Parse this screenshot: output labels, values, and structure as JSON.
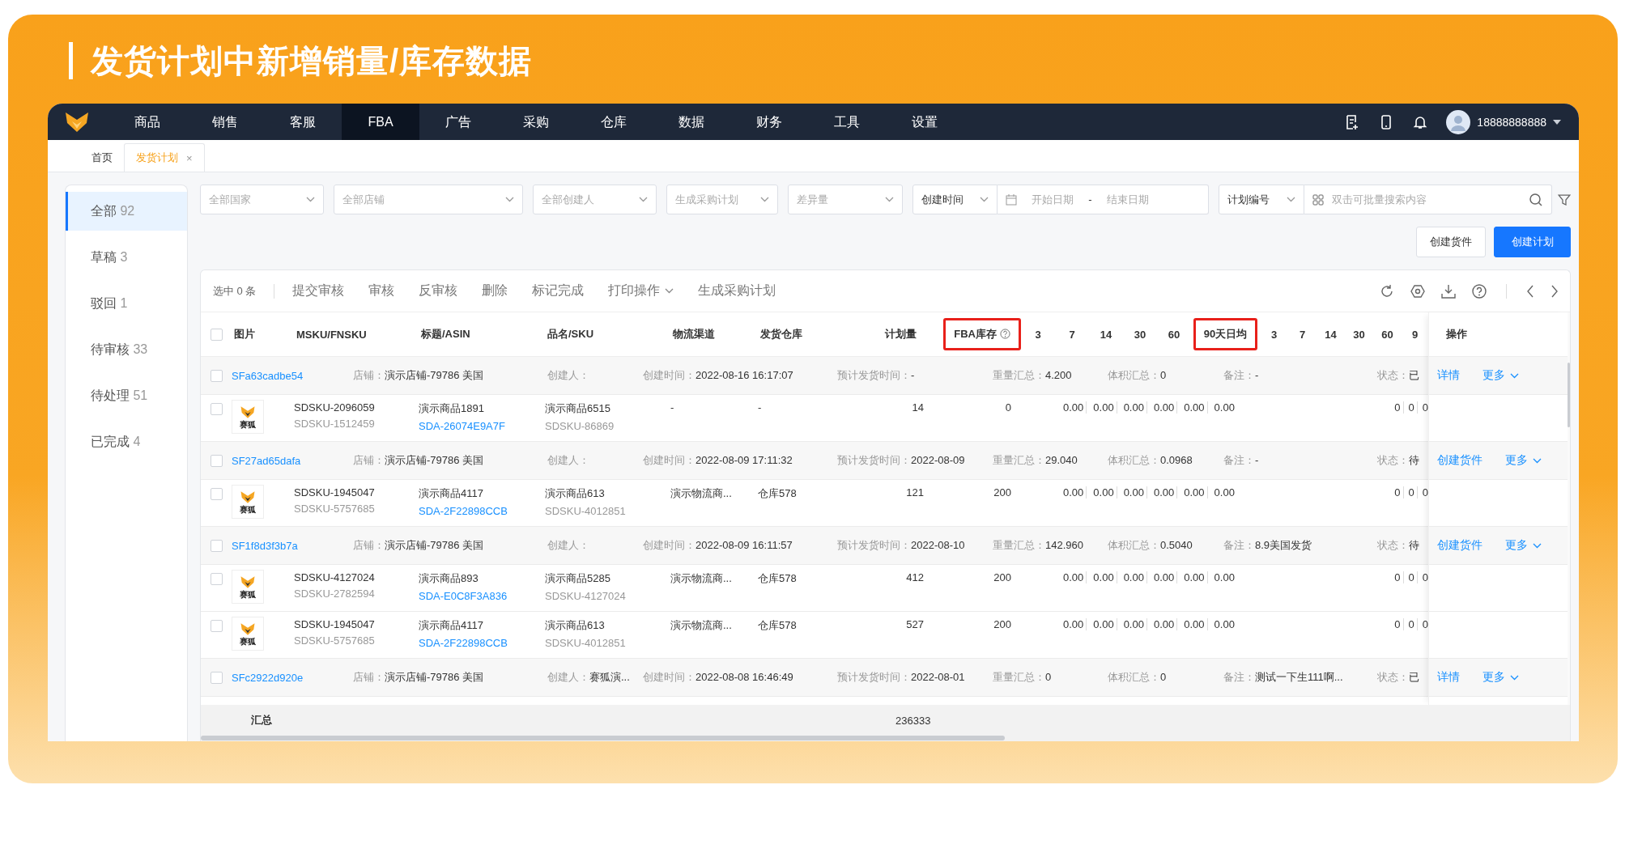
{
  "banner": {
    "title": "发货计划中新增销量/库存数据"
  },
  "nav": {
    "items": [
      {
        "label": "商品",
        "selected": false
      },
      {
        "label": "销售",
        "selected": false
      },
      {
        "label": "客服",
        "selected": false
      },
      {
        "label": "FBA",
        "selected": true
      },
      {
        "label": "广告",
        "selected": false
      },
      {
        "label": "采购",
        "selected": false
      },
      {
        "label": "仓库",
        "selected": false
      },
      {
        "label": "数据",
        "selected": false
      },
      {
        "label": "财务",
        "selected": false
      },
      {
        "label": "工具",
        "selected": false
      },
      {
        "label": "设置",
        "selected": false
      }
    ],
    "user": "18888888888"
  },
  "tabs": [
    {
      "label": "首页",
      "selected": false
    },
    {
      "label": "发货计划",
      "selected": true,
      "close": "×"
    }
  ],
  "sidebar": {
    "items": [
      {
        "label": "全部",
        "count": "92",
        "selected": true
      },
      {
        "label": "草稿",
        "count": "3",
        "selected": false
      },
      {
        "label": "驳回",
        "count": "1",
        "selected": false
      },
      {
        "label": "待审核",
        "count": "33",
        "selected": false
      },
      {
        "label": "待处理",
        "count": "51",
        "selected": false
      },
      {
        "label": "已完成",
        "count": "4",
        "selected": false
      }
    ]
  },
  "filters": [
    {
      "kind": "select",
      "placeholder": "全部国家"
    },
    {
      "kind": "select",
      "placeholder": "全部店铺"
    },
    {
      "kind": "select",
      "placeholder": "全部创建人"
    },
    {
      "kind": "select",
      "placeholder": "生成采购计划"
    },
    {
      "kind": "select",
      "placeholder": "差异量"
    },
    {
      "kind": "select",
      "value": "创建时间",
      "joined": true
    },
    {
      "kind": "daterange",
      "start": "开始日期",
      "separator": "-",
      "end": "结束日期"
    },
    {
      "kind": "select",
      "value": "计划编号",
      "joined": true
    },
    {
      "kind": "search",
      "placeholder": "双击可批量搜索内容"
    }
  ],
  "buttons": [
    {
      "label": "创建货件",
      "primary": false
    },
    {
      "label": "创建计划",
      "primary": true
    }
  ],
  "toolbar": {
    "selection": "选中 0 条",
    "actions": [
      {
        "label": "提交审核",
        "dropdown": false
      },
      {
        "label": "审核",
        "dropdown": false
      },
      {
        "label": "反审核",
        "dropdown": false
      },
      {
        "label": "删除",
        "dropdown": false
      },
      {
        "label": "标记完成",
        "dropdown": false
      },
      {
        "label": "打印操作",
        "dropdown": true
      },
      {
        "label": "生成采购计划",
        "dropdown": false
      }
    ]
  },
  "table": {
    "checked": false,
    "columns": [
      {
        "label": "图片",
        "highlighted": false
      },
      {
        "label": "MSKU/FNSKU",
        "highlighted": false
      },
      {
        "label": "标题/ASIN",
        "highlighted": false
      },
      {
        "label": "品名/SKU",
        "highlighted": false
      },
      {
        "label": "物流渠道",
        "highlighted": false
      },
      {
        "label": "发货仓库",
        "highlighted": false
      },
      {
        "label": "计划量",
        "highlighted": false
      },
      {
        "label": "FBA库存",
        "highlighted": true,
        "help": true
      },
      {
        "label": "3",
        "highlighted": false
      },
      {
        "label": "7",
        "highlighted": false
      },
      {
        "label": "14",
        "highlighted": false
      },
      {
        "label": "30",
        "highlighted": false
      },
      {
        "label": "60",
        "highlighted": false
      },
      {
        "label": "90天日均",
        "highlighted": true
      },
      {
        "label": "3",
        "highlighted": false
      },
      {
        "label": "7",
        "highlighted": false
      },
      {
        "label": "14",
        "highlighted": false
      },
      {
        "label": "30",
        "highlighted": false
      },
      {
        "label": "60",
        "highlighted": false
      },
      {
        "label": "9",
        "highlighted": false
      }
    ],
    "actions_column": "操作",
    "groups": [
      {
        "code": "SFa63cadbe54",
        "checked": false,
        "fields": [
          {
            "label": "店铺：",
            "value": "演示店铺-79786 美国"
          },
          {
            "label": "创建人："
          },
          {
            "label": "创建时间：",
            "value": "2022-08-16 16:17:07"
          },
          {
            "label": "预计发货时间：",
            "value": "-"
          },
          {
            "label": "重量汇总：",
            "value": "4.200"
          },
          {
            "label": "体积汇总：",
            "value": "0"
          },
          {
            "label": "备注：",
            "value": "-"
          },
          {
            "label": "状态：",
            "value": "已"
          }
        ],
        "ops": [
          {
            "label": "详情",
            "dropdown": false
          },
          {
            "label": "更多",
            "dropdown": true
          }
        ],
        "items": [
          {
            "checked": false,
            "image_text": "赛狐",
            "msku": "SDSKU-2096059",
            "fnsku": "SDSKU-1512459",
            "title": "演示商品1891",
            "asin": "SDA-26074E9A7F",
            "name": "演示商品6515",
            "sku": "SDSKU-86869",
            "logistics": "-",
            "warehouse": "-",
            "plan_qty": "14",
            "fba_stock": "0",
            "daily": [
              "0.00",
              "0.00",
              "0.00",
              "0.00",
              "0.00",
              "0.00"
            ],
            "sales": [
              "0",
              "0",
              "0"
            ]
          }
        ]
      },
      {
        "code": "SF27ad65dafa",
        "checked": false,
        "fields": [
          {
            "label": "店铺：",
            "value": "演示店铺-79786 美国"
          },
          {
            "label": "创建人："
          },
          {
            "label": "创建时间：",
            "value": "2022-08-09 17:11:32"
          },
          {
            "label": "预计发货时间：",
            "value": "2022-08-09"
          },
          {
            "label": "重量汇总：",
            "value": "29.040"
          },
          {
            "label": "体积汇总：",
            "value": "0.0968"
          },
          {
            "label": "备注：",
            "value": "-"
          },
          {
            "label": "状态：",
            "value": "待"
          }
        ],
        "ops": [
          {
            "label": "创建货件",
            "dropdown": false
          },
          {
            "label": "更多",
            "dropdown": true
          }
        ],
        "items": [
          {
            "checked": false,
            "image_text": "赛狐",
            "msku": "SDSKU-1945047",
            "fnsku": "SDSKU-5757685",
            "title": "演示商品4117",
            "asin": "SDA-2F22898CCB",
            "name": "演示商品613",
            "sku": "SDSKU-4012851",
            "logistics": "演示物流商...",
            "warehouse": "仓库578",
            "plan_qty": "121",
            "fba_stock": "200",
            "daily": [
              "0.00",
              "0.00",
              "0.00",
              "0.00",
              "0.00",
              "0.00"
            ],
            "sales": [
              "0",
              "0",
              "0"
            ]
          }
        ]
      },
      {
        "code": "SF1f8d3f3b7a",
        "checked": false,
        "fields": [
          {
            "label": "店铺：",
            "value": "演示店铺-79786 美国"
          },
          {
            "label": "创建人："
          },
          {
            "label": "创建时间：",
            "value": "2022-08-09 16:11:57"
          },
          {
            "label": "预计发货时间：",
            "value": "2022-08-10"
          },
          {
            "label": "重量汇总：",
            "value": "142.960"
          },
          {
            "label": "体积汇总：",
            "value": "0.5040"
          },
          {
            "label": "备注：",
            "value": "8.9美国发货"
          },
          {
            "label": "状态：",
            "value": "待"
          }
        ],
        "ops": [
          {
            "label": "创建货件",
            "dropdown": false
          },
          {
            "label": "更多",
            "dropdown": true
          }
        ],
        "items": [
          {
            "checked": false,
            "image_text": "赛狐",
            "msku": "SDSKU-4127024",
            "fnsku": "SDSKU-2782594",
            "title": "演示商品893",
            "asin": "SDA-E0C8F3A836",
            "name": "演示商品5285",
            "sku": "SDSKU-4127024",
            "logistics": "演示物流商...",
            "warehouse": "仓库578",
            "plan_qty": "412",
            "fba_stock": "200",
            "daily": [
              "0.00",
              "0.00",
              "0.00",
              "0.00",
              "0.00",
              "0.00"
            ],
            "sales": [
              "0",
              "0",
              "0"
            ]
          },
          {
            "checked": false,
            "image_text": "赛狐",
            "msku": "SDSKU-1945047",
            "fnsku": "SDSKU-5757685",
            "title": "演示商品4117",
            "asin": "SDA-2F22898CCB",
            "name": "演示商品613",
            "sku": "SDSKU-4012851",
            "logistics": "演示物流商...",
            "warehouse": "仓库578",
            "plan_qty": "527",
            "fba_stock": "200",
            "daily": [
              "0.00",
              "0.00",
              "0.00",
              "0.00",
              "0.00",
              "0.00"
            ],
            "sales": [
              "0",
              "0",
              "0"
            ]
          }
        ]
      },
      {
        "code": "SFc2922d920e",
        "checked": false,
        "fields": [
          {
            "label": "店铺：",
            "value": "演示店铺-79786 美国"
          },
          {
            "label": "创建人：",
            "value": "赛狐演..."
          },
          {
            "label": "创建时间：",
            "value": "2022-08-08 16:46:49"
          },
          {
            "label": "预计发货时间：",
            "value": "2022-08-01"
          },
          {
            "label": "重量汇总：",
            "value": "0"
          },
          {
            "label": "体积汇总：",
            "value": "0"
          },
          {
            "label": "备注：",
            "value": "测试一下生111啊..."
          },
          {
            "label": "状态：",
            "value": "已"
          }
        ],
        "ops": [
          {
            "label": "详情",
            "dropdown": false
          },
          {
            "label": "更多",
            "dropdown": true
          }
        ]
      }
    ],
    "summary": {
      "label": "汇总",
      "plan_total": "236333"
    }
  }
}
